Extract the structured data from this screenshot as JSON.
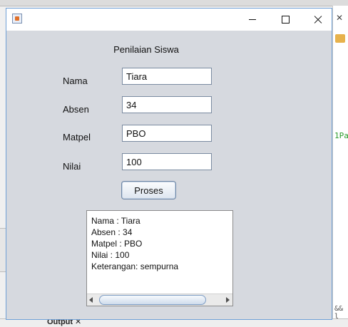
{
  "ide": {
    "output_tab_label": "Output",
    "output_tab_close": "✕",
    "code_snippet": "1Pa",
    "bottom_snippet": "&& l",
    "close_glyph": "✕"
  },
  "window": {
    "title": "",
    "controls": [
      "minimize",
      "maximize",
      "close"
    ]
  },
  "form": {
    "title": "Penilaian Siswa",
    "fields": [
      {
        "label": "Nama",
        "value": "Tiara"
      },
      {
        "label": "Absen",
        "value": "34"
      },
      {
        "label": "Matpel",
        "value": "PBO"
      },
      {
        "label": "Nilai",
        "value": "100"
      }
    ],
    "button_label": "Proses"
  },
  "output": {
    "lines": [
      "Nama : Tiara",
      "Absen : 34",
      "Matpel : PBO",
      "Nilai : 100",
      "Keterangan: sempurna"
    ]
  }
}
